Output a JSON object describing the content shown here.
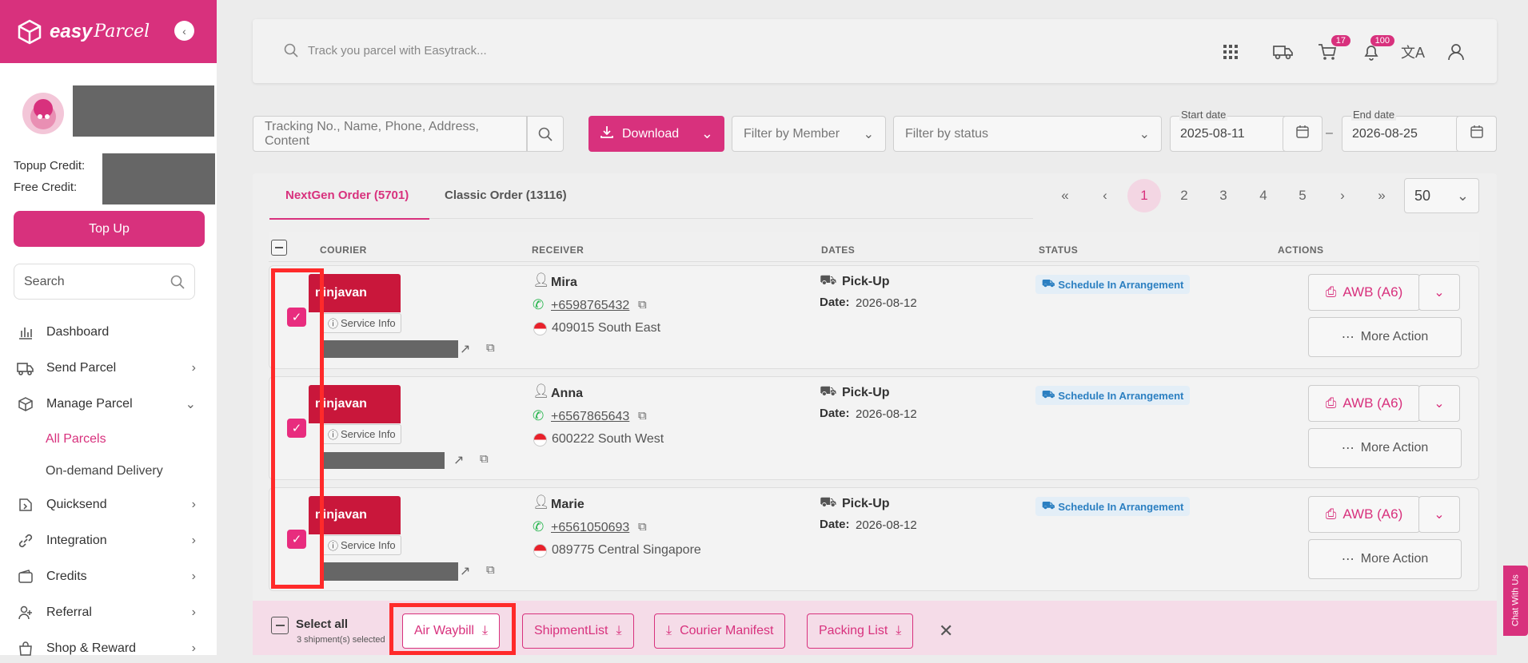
{
  "brand": {
    "name": "easy",
    "sub": "Parcel"
  },
  "sidebar": {
    "topup_credit_label": "Topup Credit:",
    "free_credit_label": "Free Credit:",
    "topup_button": "Top Up",
    "search_placeholder": "Search",
    "nav": [
      {
        "label": "Dashboard",
        "icon": "bar-chart-icon"
      },
      {
        "label": "Send Parcel",
        "icon": "truck-icon"
      },
      {
        "label": "Manage Parcel",
        "icon": "box-icon"
      },
      {
        "label": "Quicksend",
        "icon": "quicksend-icon"
      },
      {
        "label": "Integration",
        "icon": "link-icon"
      },
      {
        "label": "Credits",
        "icon": "wallet-icon"
      },
      {
        "label": "Referral",
        "icon": "user-plus-icon"
      },
      {
        "label": "Shop & Reward",
        "icon": "shop-icon"
      }
    ],
    "sub_nav": [
      "All Parcels",
      "On-demand Delivery"
    ]
  },
  "topbar": {
    "track_placeholder": "Track you parcel with Easytrack...",
    "cart_badge": "17",
    "notif_badge": "100"
  },
  "filters": {
    "search_placeholder": "Tracking No., Name, Phone, Address, Content",
    "download_label": "Download",
    "member_placeholder": "Filter by Member",
    "status_placeholder": "Filter by status",
    "start_label": "Start date",
    "start_value": "2025-08-11",
    "end_label": "End date",
    "end_value": "2026-08-25",
    "dash": "–"
  },
  "tabs": [
    {
      "label": "NextGen Order (5701)",
      "active": true
    },
    {
      "label": "Classic Order (13116)",
      "active": false
    }
  ],
  "pagination": {
    "first": "«",
    "prev": "‹",
    "pages": [
      "1",
      "2",
      "3",
      "4",
      "5"
    ],
    "next": "›",
    "last": "»",
    "per_page": "50"
  },
  "columns": [
    "COURIER",
    "RECEIVER",
    "DATES",
    "STATUS",
    "ACTIONS"
  ],
  "rows": [
    {
      "courier": "ninjavan",
      "service": "Service Info",
      "name": "Mira",
      "phone": "+6598765432",
      "address": "409015 South East",
      "pickup": "Pick-Up",
      "date_label": "Date:",
      "date": "2026-08-12",
      "status": "Schedule In Arrangement",
      "awb": "AWB (A6)",
      "more": "More Action"
    },
    {
      "courier": "ninjavan",
      "service": "Service Info",
      "name": "Anna",
      "phone": "+6567865643",
      "address": "600222 South West",
      "pickup": "Pick-Up",
      "date_label": "Date:",
      "date": "2026-08-12",
      "status": "Schedule In Arrangement",
      "awb": "AWB (A6)",
      "more": "More Action"
    },
    {
      "courier": "ninjavan",
      "service": "Service Info",
      "name": "Marie",
      "phone": "+6561050693",
      "address": "089775 Central Singapore",
      "pickup": "Pick-Up",
      "date_label": "Date:",
      "date": "2026-08-12",
      "status": "Schedule In Arrangement",
      "awb": "AWB (A6)",
      "more": "More Action"
    }
  ],
  "bottom": {
    "select_all": "Select all",
    "selected_count": "3 shipment(s) selected",
    "air_waybill": "Air Waybill",
    "shipment_list": "ShipmentList",
    "courier_manifest": "Courier Manifest",
    "packing_list": "Packing List"
  },
  "chat_tab": "Chat With Us",
  "colors": {
    "brand": "#d8317d",
    "status_blue": "#2b7fc1",
    "highlight": "#ff2a2a"
  }
}
